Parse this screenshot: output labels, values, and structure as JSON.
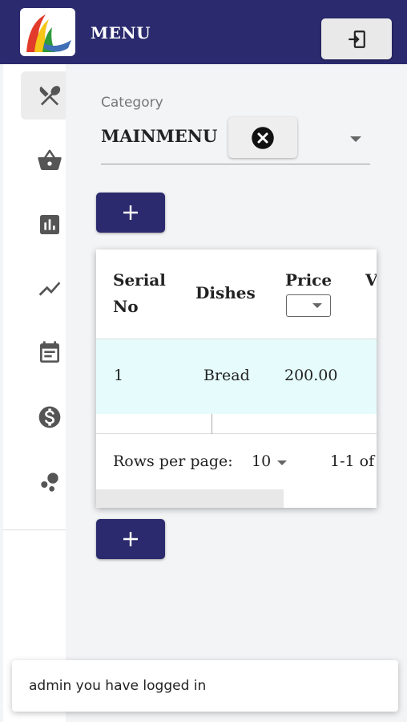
{
  "app": {
    "title": "MENU"
  },
  "header": {
    "logout_icon": "logout-icon"
  },
  "sidebar": {
    "items": [
      {
        "icon": "utensils-icon",
        "active": true
      },
      {
        "icon": "basket-icon",
        "active": false
      },
      {
        "icon": "bar-chart-icon",
        "active": false
      },
      {
        "icon": "trend-line-icon",
        "active": false
      },
      {
        "icon": "calendar-icon",
        "active": false
      },
      {
        "icon": "dollar-icon",
        "active": false
      },
      {
        "icon": "dots-icon",
        "active": false
      }
    ]
  },
  "category": {
    "label": "Category",
    "value": "MAINMENU",
    "clear_icon": "close-circle-icon"
  },
  "buttons": {
    "add_icon": "plus-icon"
  },
  "table": {
    "headers": {
      "serial": "Serial No",
      "dishes": "Dishes",
      "price": "Price",
      "more": "V"
    },
    "rows": [
      {
        "serial": "1",
        "dish": "Bread",
        "price": "200.00"
      }
    ],
    "pagination": {
      "rows_label": "Rows per page:",
      "rows_value": "10",
      "range": "1-1 of"
    }
  },
  "snackbar": {
    "message": "admin you have logged in"
  },
  "colors": {
    "primary": "#2b2a6e",
    "row_highlight": "#e6fcfc"
  }
}
